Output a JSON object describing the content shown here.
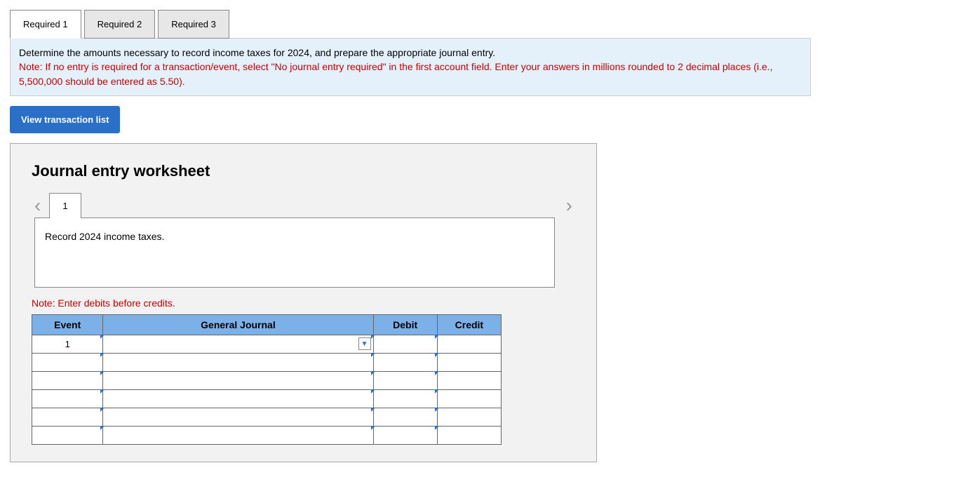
{
  "tabs": [
    {
      "label": "Required 1",
      "active": true
    },
    {
      "label": "Required 2",
      "active": false
    },
    {
      "label": "Required 3",
      "active": false
    }
  ],
  "instructions": {
    "main": "Determine the amounts necessary to record income taxes for 2024, and prepare the appropriate journal entry.",
    "note": "Note: If no entry is required for a transaction/event, select \"No journal entry required\" in the first account field. Enter your answers in millions rounded to 2 decimal places (i.e., 5,500,000 should be entered as 5.50)."
  },
  "buttons": {
    "view_list": "View transaction list"
  },
  "worksheet": {
    "title": "Journal entry worksheet",
    "step_number": "1",
    "entry_description": "Record 2024 income taxes.",
    "debits_note": "Note: Enter debits before credits.",
    "headers": {
      "event": "Event",
      "journal": "General Journal",
      "debit": "Debit",
      "credit": "Credit"
    },
    "rows": [
      {
        "event": "1",
        "is_first": true
      },
      {
        "event": "",
        "is_first": false
      },
      {
        "event": "",
        "is_first": false
      },
      {
        "event": "",
        "is_first": false
      },
      {
        "event": "",
        "is_first": false
      },
      {
        "event": "",
        "is_first": false
      }
    ]
  }
}
